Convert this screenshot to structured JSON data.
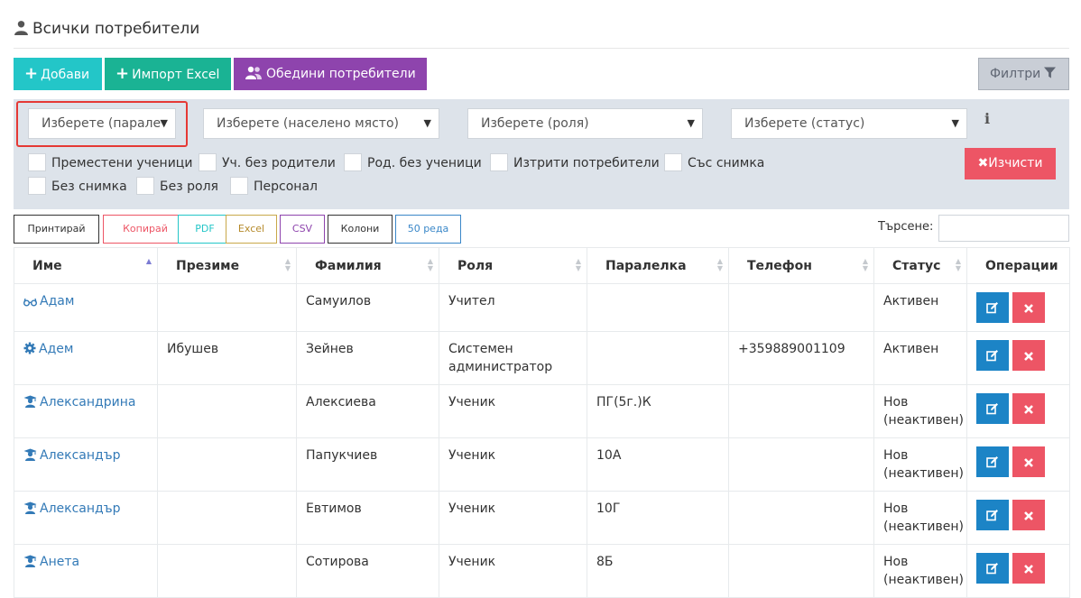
{
  "header": {
    "title": "Всички потребители"
  },
  "toolbar": {
    "add_label": "Добави",
    "import_label": "Импорт Excel",
    "merge_label": "Обедини потребители",
    "filters_label": "Филтри"
  },
  "filters": {
    "class_select": "Изберете (парале",
    "place_select": "Изберете (населено място)",
    "role_select": "Изберете (роля)",
    "status_select": "Изберете (статус)",
    "clear_label": "Изчисти",
    "checkboxes": [
      "Преместени ученици",
      "Уч. без родители",
      "Род. без ученици",
      "Изтрити потребители",
      "Със снимка",
      "Без снимка",
      "Без роля",
      "Персонал"
    ]
  },
  "export": {
    "print": "Принтирай",
    "copy": "Копирай",
    "pdf": "PDF",
    "excel": "Excel",
    "csv": "CSV",
    "columns": "Колони",
    "rows": "50 реда"
  },
  "search": {
    "label": "Търсене:"
  },
  "table": {
    "headers": [
      "Име",
      "Презиме",
      "Фамилия",
      "Роля",
      "Паралелка",
      "Телефон",
      "Статус",
      "Операции"
    ],
    "rows": [
      {
        "icon": "glasses-icon",
        "first": "Адам",
        "middle": "",
        "last": "Самуилов",
        "role": "Учител",
        "class": "",
        "phone": "",
        "status": "Активен"
      },
      {
        "icon": "gear-icon",
        "first": "Адем",
        "middle": "Ибушев",
        "last": "Зейнев",
        "role": "Системен администратор",
        "class": "",
        "phone": "+359889001109",
        "status": "Активен"
      },
      {
        "icon": "graduate-icon",
        "first": "Александрина",
        "middle": "",
        "last": "Алексиева",
        "role": "Ученик",
        "class": "ПГ(5г.)К",
        "phone": "",
        "status": "Нов (неактивен)"
      },
      {
        "icon": "graduate-icon",
        "first": "Александър",
        "middle": "",
        "last": "Папукчиев",
        "role": "Ученик",
        "class": "10А",
        "phone": "",
        "status": "Нов (неактивен)"
      },
      {
        "icon": "graduate-icon",
        "first": "Александър",
        "middle": "",
        "last": "Евтимов",
        "role": "Ученик",
        "class": "10Г",
        "phone": "",
        "status": "Нов (неактивен)"
      },
      {
        "icon": "graduate-icon",
        "first": "Анета",
        "middle": "",
        "last": "Сотирова",
        "role": "Ученик",
        "class": "8Б",
        "phone": "",
        "status": "Нов (неактивен)"
      }
    ]
  },
  "colors": {
    "teal": "#23c6c8",
    "green": "#1ab394",
    "purple": "#8e44ad",
    "red": "#ed5565",
    "blue": "#1c84c6",
    "panel": "#dde3ea"
  }
}
